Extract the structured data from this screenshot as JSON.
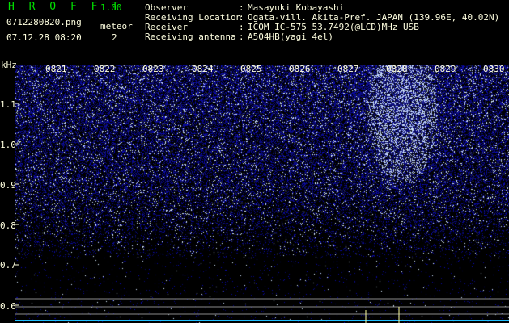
{
  "header": {
    "title": "H R O F F T",
    "version": "1.00",
    "file_name": "0712280820.png",
    "date_time": "07.12.28 08:20",
    "meteor_label": "meteor",
    "meteor_count": "2"
  },
  "meta": [
    {
      "key": "Observer",
      "value": "Masayuki Kobayashi"
    },
    {
      "key": "Receiving Location",
      "value": "Ogata-vill. Akita-Pref. JAPAN (139.96E, 40.02N)"
    },
    {
      "key": "Receiver",
      "value": "ICOM IC-575 53.7492(@LCD)MHz USB"
    },
    {
      "key": "Receiving antenna",
      "value": "A504HB(yagi 4el)"
    }
  ],
  "y_axis": {
    "unit": "kHz",
    "ticks": [
      "1.1",
      "1.0",
      "0.9",
      "0.8",
      "0.7",
      "0.6"
    ]
  },
  "x_axis": {
    "ticks": [
      "0821",
      "0822",
      "0823",
      "0824",
      "0825",
      "0826",
      "0827",
      "0828",
      "0829",
      "0830"
    ]
  },
  "colors": {
    "background": "#000000",
    "text": "#ffffe0",
    "title_green": "#00e000",
    "noise_dark": "#0a0a6e",
    "noise_bright": "#e6ecff",
    "meteor_line": "#ffffa0",
    "baseline": "#20c0ff",
    "ref_line": "#8a8a8a"
  }
}
